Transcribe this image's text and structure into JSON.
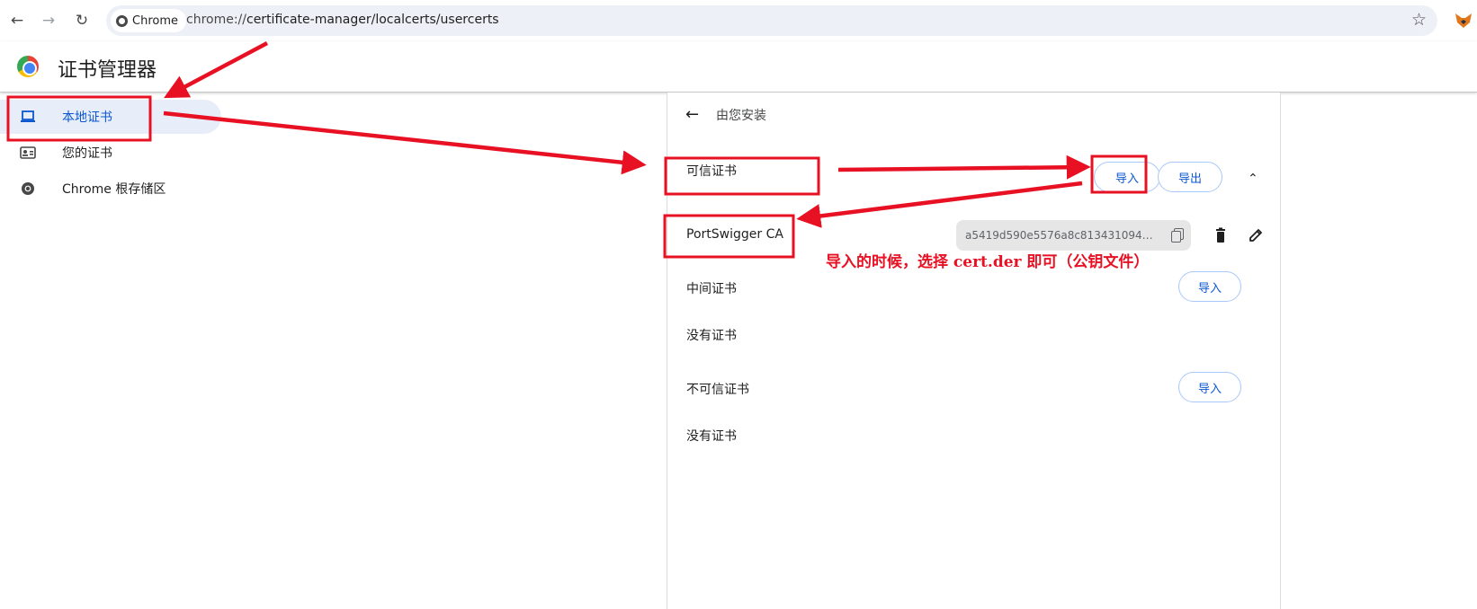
{
  "browser": {
    "chip_label": "Chrome",
    "url_scheme": "chrome://",
    "url_rest": "certificate-manager/localcerts/usercerts"
  },
  "app": {
    "title": "证书管理器"
  },
  "sidebar": {
    "items": [
      {
        "label": "本地证书",
        "icon": "laptop-icon",
        "active": true
      },
      {
        "label": "您的证书",
        "icon": "id-card-icon",
        "active": false
      },
      {
        "label": "Chrome 根存储区",
        "icon": "chrome-icon",
        "active": false
      }
    ]
  },
  "main": {
    "back_label": "由您安装",
    "trusted": {
      "label": "可信证书",
      "import_label": "导入",
      "export_label": "导出",
      "cert_name": "PortSwigger CA",
      "cert_hash": "a5419d590e5576a8c813431094875cf7f..."
    },
    "intermediate": {
      "label": "中间证书",
      "import_label": "导入",
      "empty_text": "没有证书"
    },
    "untrusted": {
      "label": "不可信证书",
      "import_label": "导入",
      "empty_text": "没有证书"
    }
  },
  "annotation": {
    "note": "导入的时候，选择  cert.der 即可（公钥文件）",
    "color": "#e81123"
  }
}
